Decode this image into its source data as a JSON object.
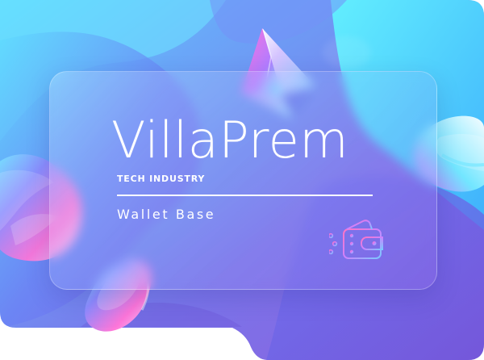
{
  "card": {
    "brand": "VillaPrem",
    "industry": "TECH INDUSTRY",
    "product": "Wallet Base",
    "icon": "wallet-circuit-icon"
  },
  "colors": {
    "background_start": "#5f86f1",
    "background_end": "#8a62df",
    "accent_cyan": "#55e5ff",
    "accent_pink": "#dd67ff",
    "text": "#ffffff"
  },
  "decorations": [
    "crystal-pyramid-icon",
    "holographic-blob-left-icon",
    "holographic-ring-right-icon",
    "holographic-coin-icon"
  ]
}
